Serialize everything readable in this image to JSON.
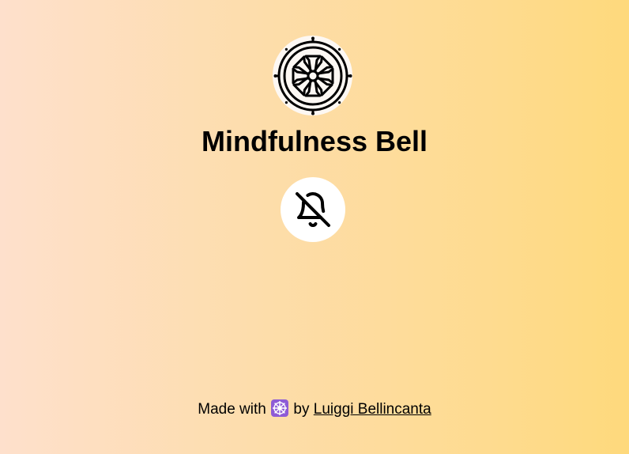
{
  "app": {
    "title": "Mindfulness Bell",
    "logo_icon": "dharma-wheel-icon",
    "bell_button_icon": "bell-off-icon"
  },
  "footer": {
    "prefix": "Made with",
    "emoji_icon": "wheel-of-dharma-emoji-icon",
    "by": "by",
    "author": "Luiggi Bellincanta"
  },
  "colors": {
    "gradient_start": "#fee0cc",
    "gradient_end": "#fed97c",
    "emoji_bg": "#8e5bd6"
  }
}
